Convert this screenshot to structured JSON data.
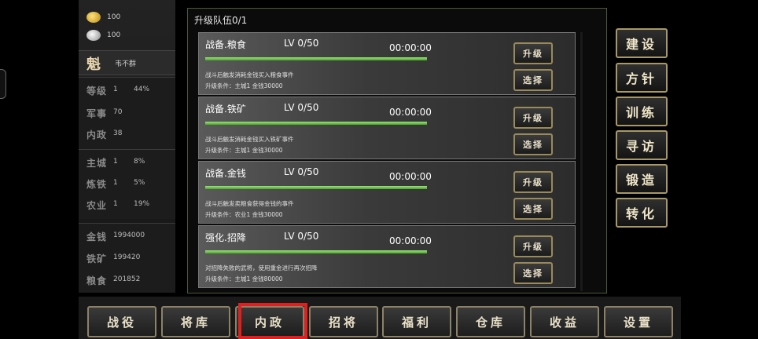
{
  "resources": {
    "gold": "100",
    "silver": "100"
  },
  "character": {
    "avatar_glyph": "魁",
    "name": "韦不群"
  },
  "stats": [
    {
      "key": "等级",
      "value": "1",
      "pct": "44%"
    },
    {
      "key": "军事",
      "value": "70",
      "pct": ""
    },
    {
      "key": "内政",
      "value": "38",
      "pct": ""
    }
  ],
  "buildings": [
    {
      "key": "主城",
      "value": "1",
      "pct": "8%"
    },
    {
      "key": "炼铁",
      "value": "1",
      "pct": "5%"
    },
    {
      "key": "农业",
      "value": "1",
      "pct": "19%"
    }
  ],
  "stock": [
    {
      "key": "金钱",
      "value": "1994000"
    },
    {
      "key": "铁矿",
      "value": "199420"
    },
    {
      "key": "粮食",
      "value": "201852"
    }
  ],
  "panel": {
    "title": "升级队伍0/1"
  },
  "upgrades": [
    {
      "name": "战备.粮食",
      "level": "LV 0/50",
      "time": "00:00:00",
      "progress": 1.0,
      "desc": "战斗后触发消耗金钱买入粮食事件",
      "cond": "升级条件：主城1 金钱30000",
      "upgrade_label": "升级",
      "select_label": "选择"
    },
    {
      "name": "战备.铁矿",
      "level": "LV 0/50",
      "time": "00:00:00",
      "progress": 1.0,
      "desc": "战斗后触发消耗金钱买入铁矿事件",
      "cond": "升级条件：主城1 金钱30000",
      "upgrade_label": "升级",
      "select_label": "选择"
    },
    {
      "name": "战备.金钱",
      "level": "LV 0/50",
      "time": "00:00:00",
      "progress": 1.0,
      "desc": "战斗后触发卖粮食获得金钱的事件",
      "cond": "升级条件：农业1 金钱30000",
      "upgrade_label": "升级",
      "select_label": "选择"
    },
    {
      "name": "强化.招降",
      "level": "LV 0/50",
      "time": "00:00:00",
      "progress": 1.0,
      "desc": "对招降失败的武将，使用重金进行再次招降",
      "cond": "升级条件：主城1 金钱80000",
      "upgrade_label": "升级",
      "select_label": "选择"
    }
  ],
  "right_menu": [
    "建设",
    "方针",
    "训练",
    "寻访",
    "锻造",
    "转化"
  ],
  "bottom_nav": [
    "战役",
    "将库",
    "内政",
    "招将",
    "福利",
    "仓库",
    "收益",
    "设置"
  ],
  "active_tab": "内政",
  "colors": {
    "accent_border": "#a89868",
    "progress_green": "#5cbf3a",
    "highlight": "#e02020"
  }
}
